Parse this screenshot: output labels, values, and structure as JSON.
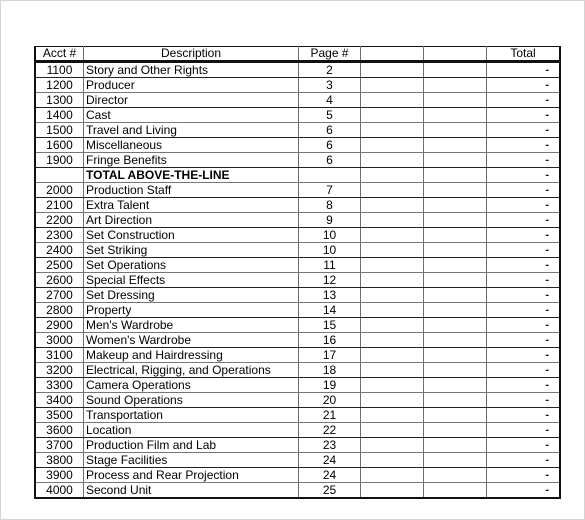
{
  "columns": {
    "acct": "Acct #",
    "description": "Description",
    "page": "Page #",
    "extra1": "",
    "extra2": "",
    "total": "Total"
  },
  "rows": [
    {
      "acct": "1100",
      "description": "Story and Other Rights",
      "page": "2",
      "total": "-"
    },
    {
      "acct": "1200",
      "description": "Producer",
      "page": "3",
      "total": "-"
    },
    {
      "acct": "1300",
      "description": "Director",
      "page": "4",
      "total": "-"
    },
    {
      "acct": "1400",
      "description": "Cast",
      "page": "5",
      "total": "-"
    },
    {
      "acct": "1500",
      "description": "Travel and Living",
      "page": "6",
      "total": "-"
    },
    {
      "acct": "1600",
      "description": "Miscellaneous",
      "page": "6",
      "total": "-"
    },
    {
      "acct": "1900",
      "description": "Fringe Benefits",
      "page": "6",
      "total": "-"
    },
    {
      "acct": "",
      "description": "TOTAL ABOVE-THE-LINE",
      "page": "",
      "total": "-",
      "bold": true
    },
    {
      "acct": "2000",
      "description": "Production Staff",
      "page": "7",
      "total": "-"
    },
    {
      "acct": "2100",
      "description": "Extra Talent",
      "page": "8",
      "total": "-"
    },
    {
      "acct": "2200",
      "description": "Art Direction",
      "page": "9",
      "total": "-"
    },
    {
      "acct": "2300",
      "description": "Set Construction",
      "page": "10",
      "total": "-"
    },
    {
      "acct": "2400",
      "description": "Set Striking",
      "page": "10",
      "total": "-"
    },
    {
      "acct": "2500",
      "description": "Set Operations",
      "page": "11",
      "total": "-"
    },
    {
      "acct": "2600",
      "description": "Special Effects",
      "page": "12",
      "total": "-"
    },
    {
      "acct": "2700",
      "description": "Set Dressing",
      "page": "13",
      "total": "-"
    },
    {
      "acct": "2800",
      "description": "Property",
      "page": "14",
      "total": "-"
    },
    {
      "acct": "2900",
      "description": "Men's Wardrobe",
      "page": "15",
      "total": "-"
    },
    {
      "acct": "3000",
      "description": "Women's Wardrobe",
      "page": "16",
      "total": "-"
    },
    {
      "acct": "3100",
      "description": "Makeup and Hairdressing",
      "page": "17",
      "total": "-"
    },
    {
      "acct": "3200",
      "description": "Electrical, Rigging, and Operations",
      "page": "18",
      "total": "-"
    },
    {
      "acct": "3300",
      "description": "Camera Operations",
      "page": "19",
      "total": "-"
    },
    {
      "acct": "3400",
      "description": "Sound Operations",
      "page": "20",
      "total": "-"
    },
    {
      "acct": "3500",
      "description": "Transportation",
      "page": "21",
      "total": "-"
    },
    {
      "acct": "3600",
      "description": "Location",
      "page": "22",
      "total": "-"
    },
    {
      "acct": "3700",
      "description": "Production Film and Lab",
      "page": "23",
      "total": "-"
    },
    {
      "acct": "3800",
      "description": "Stage Facilities",
      "page": "24",
      "total": "-"
    },
    {
      "acct": "3900",
      "description": "Process and Rear Projection",
      "page": "24",
      "total": "-"
    },
    {
      "acct": "4000",
      "description": "Second Unit",
      "page": "25",
      "total": "-"
    }
  ]
}
